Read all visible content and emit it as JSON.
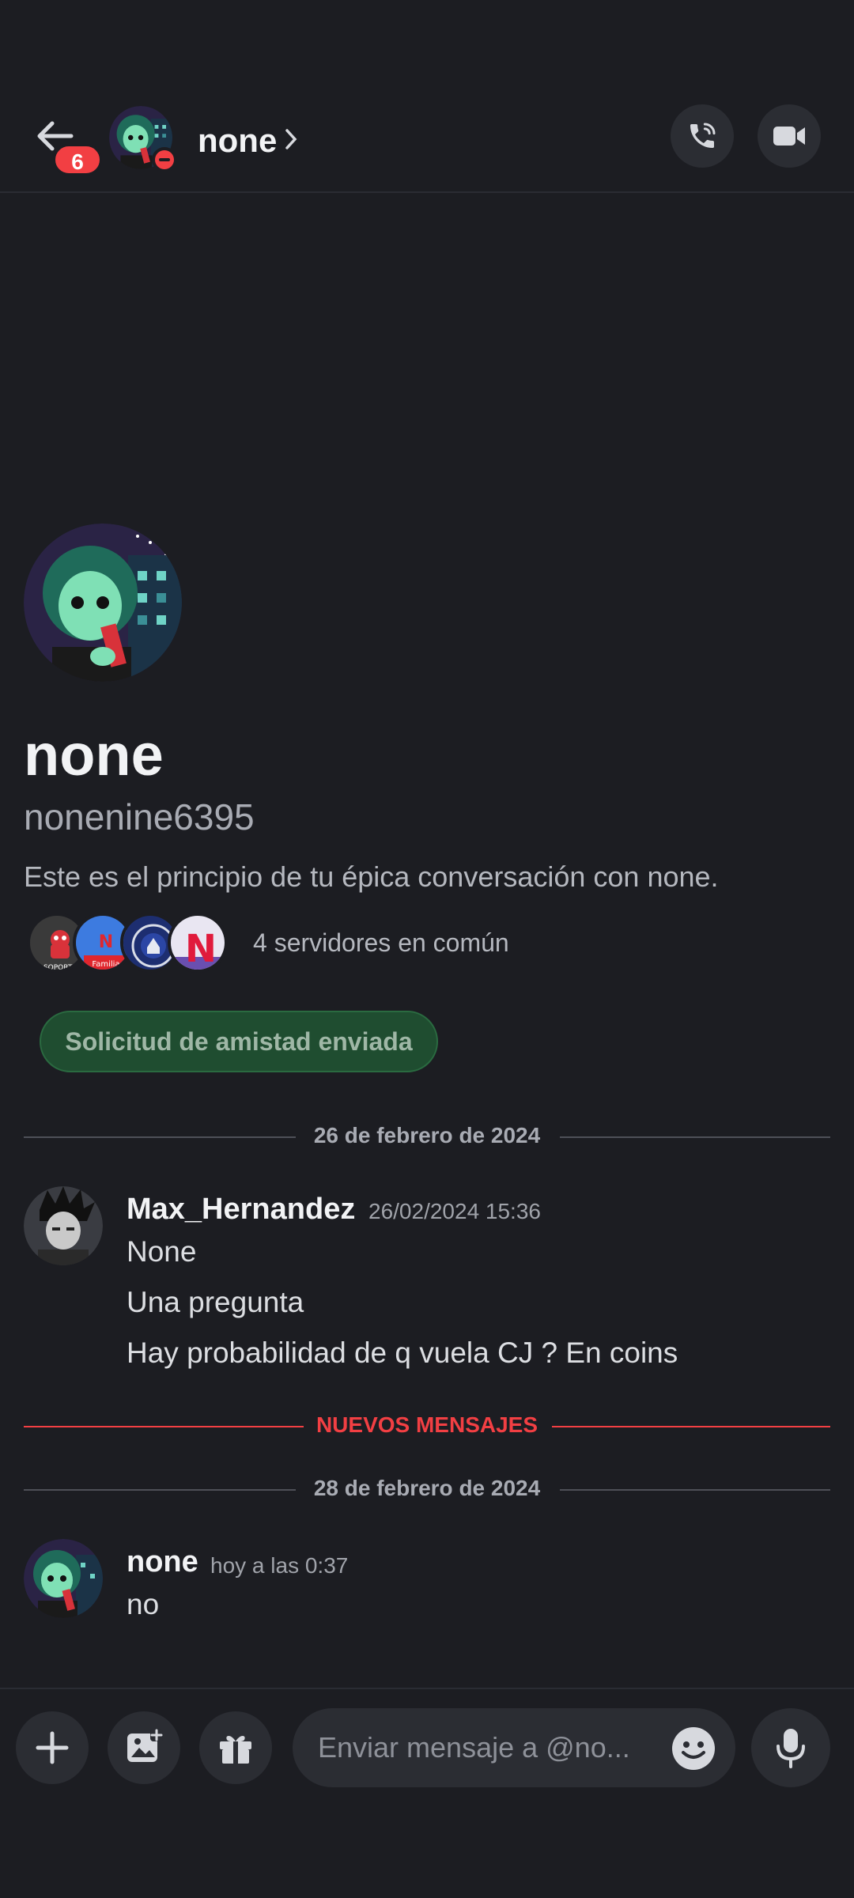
{
  "header": {
    "unread_count": "6",
    "name": "none",
    "icons": {
      "back": "arrow-left-icon",
      "chevron": "chevron-right-icon",
      "call": "phone-icon",
      "video": "video-camera-icon"
    },
    "status": "do-not-disturb"
  },
  "profile": {
    "display_name": "none",
    "username": "nonenine6395",
    "intro": "Este es el principio de tu épica conversación con none.",
    "mutual_servers_text": "4 servidores en común",
    "mutual_servers": [
      {
        "label": "SOPORTE"
      },
      {
        "label": "Familia"
      },
      {
        "label": ""
      },
      {
        "label": "N"
      }
    ],
    "friend_request_label": "Solicitud de amistad enviada"
  },
  "dividers": {
    "date1": "26 de febrero de 2024",
    "new_messages": "NUEVOS MENSAJES",
    "date2": "28 de febrero de 2024"
  },
  "messages": [
    {
      "author": "Max_Hernandez",
      "time": "26/02/2024 15:36",
      "lines": [
        "None",
        "Una pregunta",
        "Hay probabilidad de q vuela CJ ? En coins"
      ]
    },
    {
      "author": "none",
      "time": "hoy a las 0:37",
      "lines": [
        "no"
      ]
    }
  ],
  "composer": {
    "placeholder": "Enviar mensaje a @no...",
    "icons": [
      "plus-icon",
      "image-icon",
      "gift-icon",
      "emoji-icon",
      "microphone-icon"
    ]
  },
  "colors": {
    "background": "#1c1d22",
    "surface": "#2b2d33",
    "danger": "#f23f43",
    "success_bg": "#1f4d30"
  }
}
